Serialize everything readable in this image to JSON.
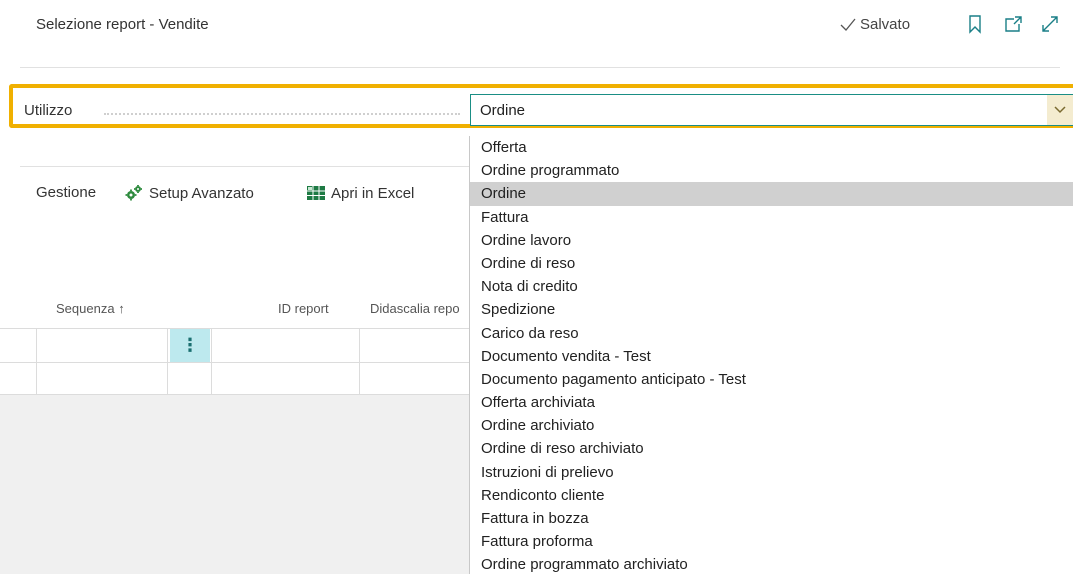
{
  "header": {
    "title": "Selezione report - Vendite",
    "saved_label": "Salvato",
    "icons": [
      "checkmark-icon",
      "bookmark-icon",
      "open-in-new-window-icon",
      "expand-icon"
    ]
  },
  "field": {
    "label": "Utilizzo",
    "value": "Ordine"
  },
  "actions": {
    "gestione": "Gestione",
    "setup_avanzato": "Setup Avanzato",
    "apri_excel": "Apri in Excel"
  },
  "grid": {
    "columns": {
      "sequenza": "Sequenza",
      "sort_indicator": "↑",
      "id_report": "ID report",
      "didascalia": "Didascalia repo"
    }
  },
  "dropdown": {
    "options": [
      "Offerta",
      "Ordine programmato",
      "Ordine",
      "Fattura",
      "Ordine lavoro",
      "Ordine di reso",
      "Nota di credito",
      "Spedizione",
      "Carico da reso",
      "Documento vendita - Test",
      "Documento pagamento anticipato - Test",
      "Offerta archiviata",
      "Ordine archiviato",
      "Ordine di reso archiviato",
      "Istruzioni di prelievo",
      "Rendiconto cliente",
      "Fattura in bozza",
      "Fattura proforma",
      "Ordine programmato archiviato"
    ],
    "selected_index": 2
  },
  "colors": {
    "focus_border": "#f0b000",
    "accent": "#1a8e85",
    "selected_bg": "#d0d0d0",
    "row_menu_bg": "#bde9ee"
  }
}
